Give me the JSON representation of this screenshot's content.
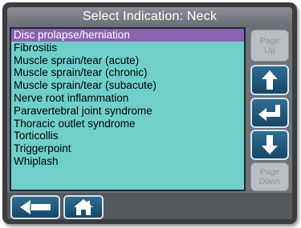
{
  "window": {
    "title": "Select Indication: Neck"
  },
  "indications": {
    "items": [
      {
        "label": "Disc prolapse/herniation",
        "selected": true
      },
      {
        "label": "Fibrositis",
        "selected": false
      },
      {
        "label": "Muscle sprain/tear (acute)",
        "selected": false
      },
      {
        "label": "Muscle sprain/tear (chronic)",
        "selected": false
      },
      {
        "label": "Muscle sprain/tear (subacute)",
        "selected": false
      },
      {
        "label": "Nerve root inflammation",
        "selected": false
      },
      {
        "label": "Paravertebral joint syndrome",
        "selected": false
      },
      {
        "label": "Thoracic outlet syndrome",
        "selected": false
      },
      {
        "label": "Torticollis",
        "selected": false
      },
      {
        "label": "Triggerpoint",
        "selected": false
      },
      {
        "label": "Whiplash",
        "selected": false
      }
    ]
  },
  "side_controls": {
    "page_up": {
      "line1": "Page",
      "line2": "Up",
      "enabled": false
    },
    "scroll_up_icon": "arrow-up-icon",
    "enter_icon": "enter-return-icon",
    "scroll_down_icon": "arrow-down-icon",
    "page_down": {
      "line1": "Page",
      "line2": "Down",
      "enabled": false
    }
  },
  "bottom_controls": {
    "back_icon": "arrow-left-icon",
    "home_icon": "home-icon"
  },
  "colors": {
    "list_background": "#6fd0cb",
    "selection": "#8a62b0",
    "button_blue": "#1f5a7e",
    "disabled_button": "#b9bec2"
  }
}
